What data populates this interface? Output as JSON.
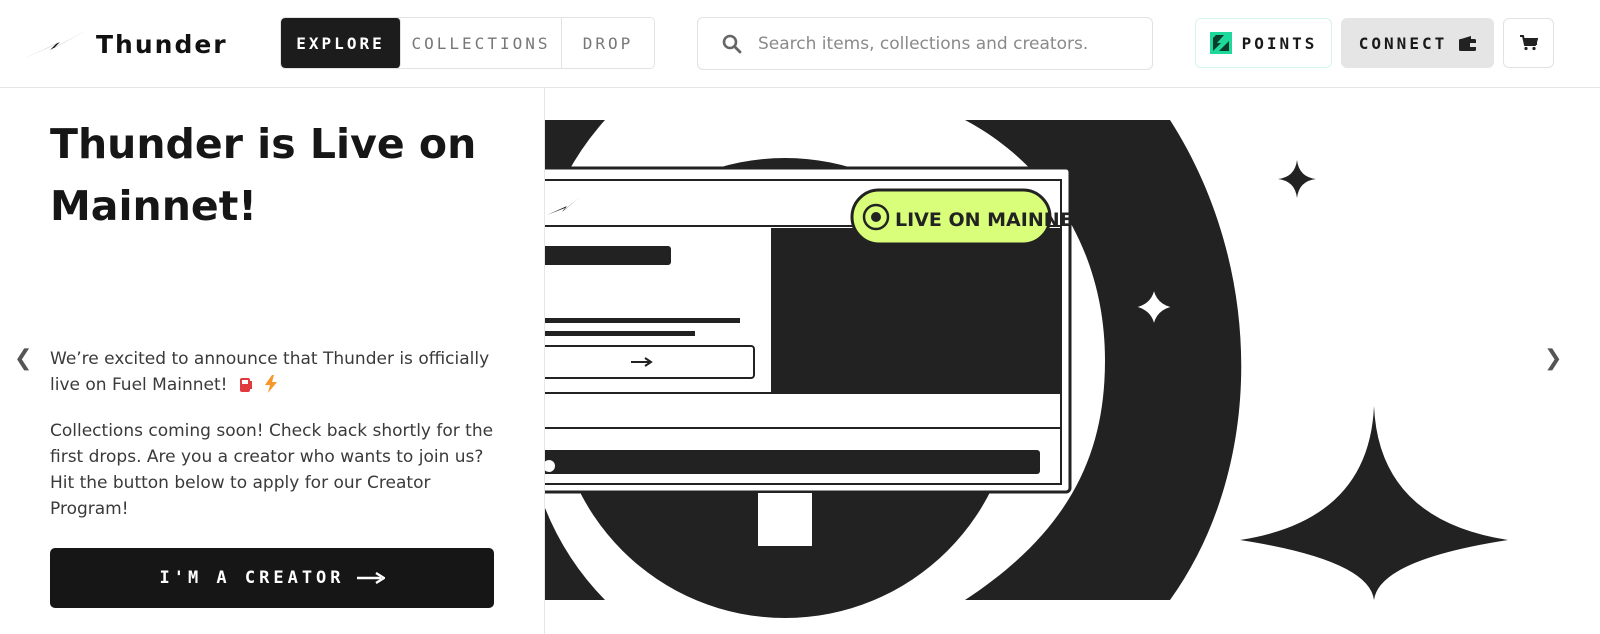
{
  "brand": {
    "name": "Thunder",
    "logo_icon": "lightning-bolt-logo"
  },
  "nav": {
    "tabs": [
      {
        "label": "EXPLORE",
        "active": true
      },
      {
        "label": "COLLECTIONS",
        "active": false
      },
      {
        "label": "DROP",
        "active": false
      }
    ]
  },
  "search": {
    "placeholder": "Search items, collections and creators.",
    "icon": "search-icon"
  },
  "header_actions": {
    "points_label": "POINTS",
    "connect_label": "CONNECT",
    "cart_icon": "cart-icon",
    "wallet_icon": "wallet-icon",
    "points_icon": "fuel-points-icon"
  },
  "hero": {
    "title": "Thunder is Live on Mainnet!",
    "description_1": "We’re excited to announce that Thunder is officially live on Fuel Mainnet!",
    "description_2": "Collections coming soon! Check back shortly for the first drops. Are you a creator who wants to join us? Hit the button below to apply for our Creator Program!",
    "cta_label": "I'M A CREATOR",
    "art_badge": "LIVE ON MAINNET!"
  },
  "carousel": {
    "prev_glyph": "❮",
    "next_glyph": "❯"
  },
  "colors": {
    "dark": "#1c1c1c",
    "accent_lime": "#d9ff7a",
    "points_green": "#1fd89b",
    "muted_bg": "#e5e5e5"
  }
}
